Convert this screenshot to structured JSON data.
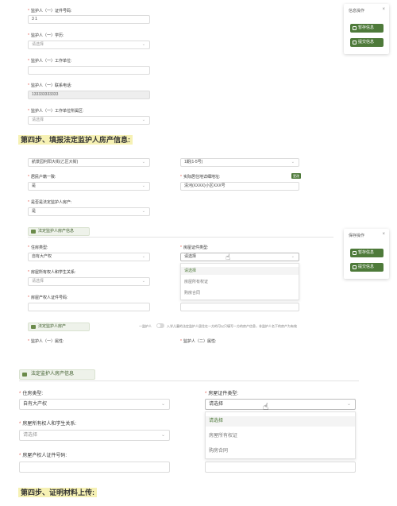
{
  "section1": {
    "fields": [
      {
        "label": "监护人（一）证件号码:",
        "value": "3 1",
        "placeholder": ""
      },
      {
        "label": "监护人（一）学历:",
        "value": "请选择",
        "placeholder": "请选择"
      },
      {
        "label": "监护人（一）工作单位:",
        "value": "",
        "placeholder": ""
      },
      {
        "label": "监护人（一）联系电话:",
        "value": "133333333333",
        "placeholder": ""
      },
      {
        "label": "监护人（一）工作单位所属区:",
        "value": "请选择",
        "placeholder": "请选择"
      }
    ],
    "side_panel": {
      "title": "信息操作",
      "save_label": "暂存信息",
      "submit_label": "提交信息"
    }
  },
  "step4": {
    "title": "第四步、填报法定监护人房产信息:"
  },
  "section2": {
    "top_row": {
      "left_value": "航景园利阳大街(乙区大街)",
      "right_value": "1期(1-5号)"
    },
    "field_area": {
      "label": "居民户籍一致:",
      "value": "是"
    },
    "field_address": {
      "label": "实际居住地详细地址:",
      "value": "清河(XXXX)小区XXX号",
      "tag": "更改"
    },
    "field_owner": {
      "label": "是否是法定监护人房产:",
      "value": "是"
    },
    "tab_label": "法定监护人房产信息",
    "field_type": {
      "label": "住房类型:",
      "value": "自有大产权"
    },
    "field_cert": {
      "label": "房屋证件类型:",
      "value": "请选择"
    },
    "field_relation": {
      "label": "房屋所有权人和学生关系:",
      "value": "请选择"
    },
    "field_certno": {
      "label": "房屋产权人证件号码:",
      "value": ""
    },
    "dropdown": [
      "请选择",
      "房屋所有权证",
      "购房合同"
    ],
    "tab2_label": "法定监护人房产",
    "switch_label": "一监护人",
    "note": "入学儿童的法定监护人居住在一方的可以只填写一方的房产信息，非监护人名下的房产为有效",
    "guardian1_label": "监护人（一）属性:",
    "guardian2_label": "监护人（二）属性:",
    "side_panel": {
      "title": "保存操作",
      "save_label": "暂存信息",
      "submit_label": "提交信息"
    }
  },
  "section3": {
    "tab_label": "法定监护人房产信息",
    "field_type": {
      "label": "住房类型:",
      "value": "自有大产权"
    },
    "field_cert": {
      "label": "房屋证件类型:",
      "value": "请选择"
    },
    "field_relation": {
      "label": "房屋所有权人和学生关系:",
      "value": "请选择"
    },
    "field_certno": {
      "label": "房屋产权人证件号码:",
      "value": ""
    },
    "dropdown": [
      "请选择",
      "房屋所有权证",
      "购房合同"
    ]
  },
  "step5": {
    "title": "第四步、证明材料上传:"
  }
}
